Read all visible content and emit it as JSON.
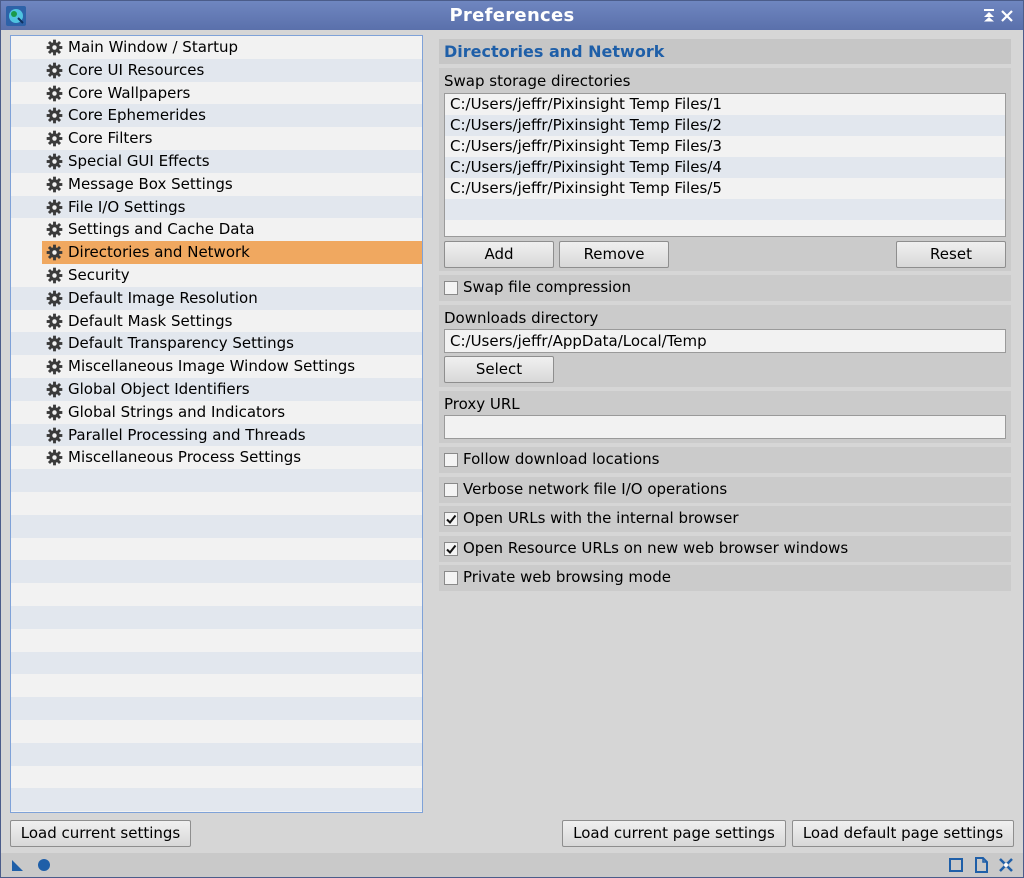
{
  "window": {
    "title": "Preferences"
  },
  "tree": {
    "items": [
      "Main Window / Startup",
      "Core UI Resources",
      "Core Wallpapers",
      "Core Ephemerides",
      "Core Filters",
      "Special GUI Effects",
      "Message Box Settings",
      "File I/O Settings",
      "Settings and Cache Data",
      "Directories and Network",
      "Security",
      "Default Image Resolution",
      "Default Mask Settings",
      "Default Transparency Settings",
      "Miscellaneous Image Window Settings",
      "Global Object Identifiers",
      "Global Strings and Indicators",
      "Parallel Processing and Threads",
      "Miscellaneous Process Settings"
    ],
    "selected_index": 9,
    "total_rows": 34
  },
  "page": {
    "title": "Directories and Network",
    "swap": {
      "label": "Swap storage directories",
      "dirs": [
        "C:/Users/jeffr/Pixinsight Temp Files/1",
        "C:/Users/jeffr/Pixinsight Temp Files/2",
        "C:/Users/jeffr/Pixinsight Temp Files/3",
        "C:/Users/jeffr/Pixinsight Temp Files/4",
        "C:/Users/jeffr/Pixinsight Temp Files/5"
      ],
      "add_label": "Add",
      "remove_label": "Remove",
      "reset_label": "Reset"
    },
    "swap_compression": {
      "label": "Swap file compression",
      "checked": false
    },
    "downloads": {
      "label": "Downloads directory",
      "value": "C:/Users/jeffr/AppData/Local/Temp",
      "select_label": "Select"
    },
    "proxy": {
      "label": "Proxy URL",
      "value": ""
    },
    "options": [
      {
        "label": "Follow download locations",
        "checked": false
      },
      {
        "label": "Verbose network file I/O operations",
        "checked": false
      },
      {
        "label": "Open URLs with the internal browser",
        "checked": true
      },
      {
        "label": "Open Resource URLs on new web browser windows",
        "checked": true
      },
      {
        "label": "Private web browsing mode",
        "checked": false
      }
    ]
  },
  "footer": {
    "load_current_label": "Load current settings",
    "load_current_page_label": "Load current page settings",
    "load_default_page_label": "Load default page settings"
  },
  "colors": {
    "title_bar": "#5f76b2",
    "selection": "#f0a860",
    "section_title": "#1f5fa8",
    "tree_border": "#7fa2d8"
  }
}
